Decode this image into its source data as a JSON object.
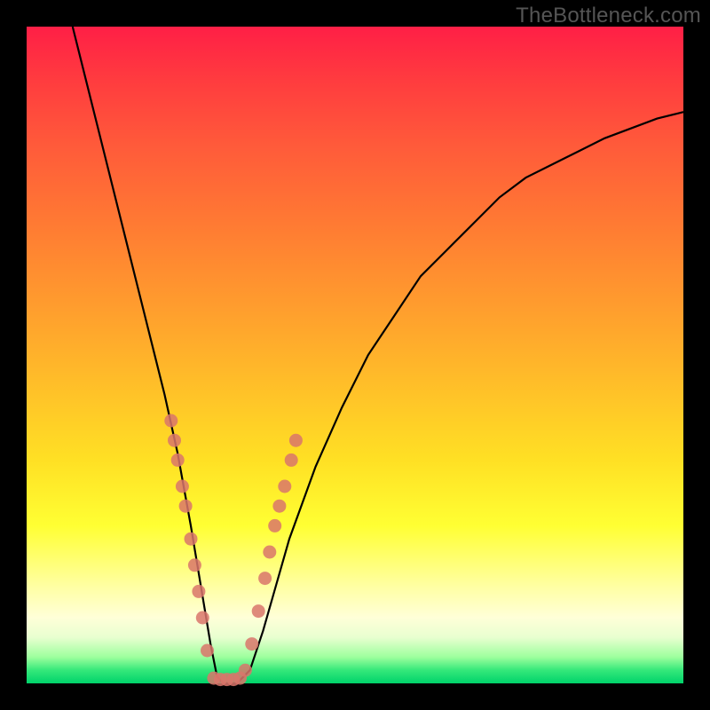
{
  "watermark": "TheBottleneck.com",
  "chart_data": {
    "type": "line",
    "title": "",
    "xlabel": "",
    "ylabel": "",
    "xlim": [
      0,
      100
    ],
    "ylim": [
      0,
      100
    ],
    "series": [
      {
        "name": "bottleneck-curve",
        "x": [
          7,
          9,
          11,
          13,
          15,
          17,
          19,
          21,
          23,
          25,
          26,
          27,
          28,
          29,
          30,
          32,
          34,
          36,
          38,
          40,
          44,
          48,
          52,
          56,
          60,
          64,
          68,
          72,
          76,
          80,
          84,
          88,
          92,
          96,
          100
        ],
        "y": [
          100,
          92,
          84,
          76,
          68,
          60,
          52,
          44,
          35,
          24,
          18,
          12,
          6,
          1,
          0,
          0,
          2,
          8,
          15,
          22,
          33,
          42,
          50,
          56,
          62,
          66,
          70,
          74,
          77,
          79,
          81,
          83,
          84.5,
          86,
          87
        ]
      }
    ],
    "markers": {
      "name": "highlight-dots",
      "color": "#d9756b",
      "points": [
        {
          "x": 22.0,
          "y": 40
        },
        {
          "x": 22.5,
          "y": 37
        },
        {
          "x": 23.0,
          "y": 34
        },
        {
          "x": 23.7,
          "y": 30
        },
        {
          "x": 24.2,
          "y": 27
        },
        {
          "x": 25.0,
          "y": 22
        },
        {
          "x": 25.6,
          "y": 18
        },
        {
          "x": 26.2,
          "y": 14
        },
        {
          "x": 26.8,
          "y": 10
        },
        {
          "x": 27.5,
          "y": 5
        },
        {
          "x": 28.5,
          "y": 0.8
        },
        {
          "x": 29.5,
          "y": 0.6
        },
        {
          "x": 30.5,
          "y": 0.6
        },
        {
          "x": 31.5,
          "y": 0.6
        },
        {
          "x": 32.5,
          "y": 0.8
        },
        {
          "x": 33.3,
          "y": 2
        },
        {
          "x": 34.3,
          "y": 6
        },
        {
          "x": 35.3,
          "y": 11
        },
        {
          "x": 36.3,
          "y": 16
        },
        {
          "x": 37.0,
          "y": 20
        },
        {
          "x": 37.8,
          "y": 24
        },
        {
          "x": 38.5,
          "y": 27
        },
        {
          "x": 39.3,
          "y": 30
        },
        {
          "x": 40.3,
          "y": 34
        },
        {
          "x": 41.0,
          "y": 37
        }
      ]
    }
  }
}
